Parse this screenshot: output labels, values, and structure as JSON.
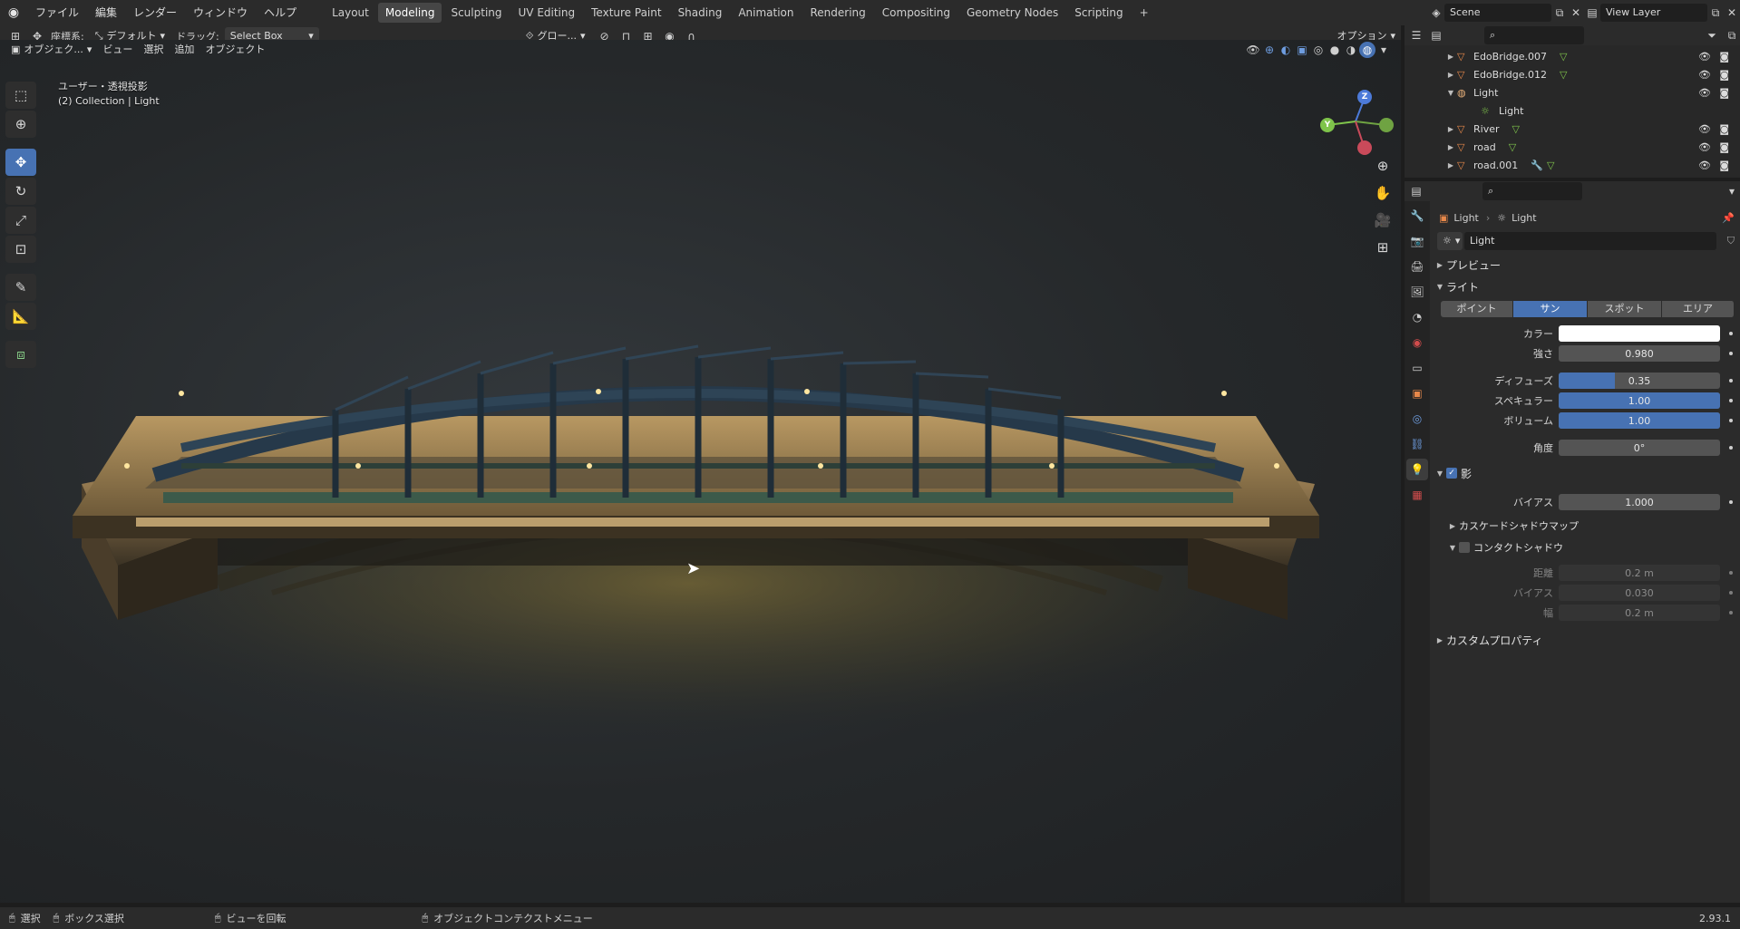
{
  "topbar": {
    "menus": [
      "ファイル",
      "編集",
      "レンダー",
      "ウィンドウ",
      "ヘルプ"
    ],
    "workspaces": [
      "Layout",
      "Modeling",
      "Sculpting",
      "UV Editing",
      "Texture Paint",
      "Shading",
      "Animation",
      "Rendering",
      "Compositing",
      "Geometry Nodes",
      "Scripting"
    ],
    "active_workspace": "Modeling",
    "scene": "Scene",
    "view_layer": "View Layer"
  },
  "tool_header": {
    "coord_label": "座標系:",
    "coord_value": "デフォルト",
    "drag_label": "ドラッグ:",
    "drag_value": "Select Box",
    "pivot_value": "グロー...",
    "options_label": "オプション"
  },
  "viewport_header": {
    "mode": "オブジェク...",
    "menus": [
      "ビュー",
      "選択",
      "追加",
      "オブジェクト"
    ]
  },
  "viewport_overlay": {
    "line1": "ユーザー・透視投影",
    "line2": "(2) Collection | Light"
  },
  "gizmo": {
    "z": "Z",
    "y": "Y"
  },
  "outliner": {
    "items": [
      {
        "name": "EdoBridge.007",
        "expanded": false,
        "type": "mesh"
      },
      {
        "name": "EdoBridge.012",
        "expanded": false,
        "type": "mesh"
      },
      {
        "name": "Light",
        "expanded": true,
        "type": "light"
      },
      {
        "name": "Light",
        "expanded": false,
        "type": "light-data"
      },
      {
        "name": "River",
        "expanded": false,
        "type": "mesh"
      },
      {
        "name": "road",
        "expanded": false,
        "type": "mesh"
      },
      {
        "name": "road.001",
        "expanded": false,
        "type": "mesh"
      }
    ]
  },
  "properties": {
    "breadcrumb_object": "Light",
    "breadcrumb_data": "Light",
    "datablock_name": "Light",
    "sections": {
      "preview": "プレビュー",
      "light": "ライト",
      "shadow": "影",
      "cascade": "カスケードシャドウマップ",
      "contact": "コンタクトシャドウ",
      "custom": "カスタムプロパティ"
    },
    "light_types": [
      "ポイント",
      "サン",
      "スポット",
      "エリア"
    ],
    "active_light_type": "サン",
    "fields": {
      "color_label": "カラー",
      "strength_label": "強さ",
      "strength_value": "0.980",
      "diffuse_label": "ディフューズ",
      "diffuse_value": "0.35",
      "diffuse_fill": 0.35,
      "specular_label": "スペキュラー",
      "specular_value": "1.00",
      "specular_fill": 1.0,
      "volume_label": "ボリューム",
      "volume_value": "1.00",
      "volume_fill": 1.0,
      "angle_label": "角度",
      "angle_value": "0°",
      "bias_label": "バイアス",
      "bias_value": "1.000",
      "contact_distance_label": "距離",
      "contact_distance_value": "0.2 m",
      "contact_bias_label": "バイアス",
      "contact_bias_value": "0.030",
      "contact_width_label": "幅",
      "contact_width_value": "0.2 m"
    },
    "shadow_enabled": true,
    "contact_enabled": false
  },
  "statusbar": {
    "select": "選択",
    "box_select": "ボックス選択",
    "rotate_view": "ビューを回転",
    "context_menu": "オブジェクトコンテクストメニュー",
    "version": "2.93.1"
  },
  "colors": {
    "accent": "#4772b3",
    "mesh_icon": "#e8884a",
    "light_color": "#ffffff"
  }
}
